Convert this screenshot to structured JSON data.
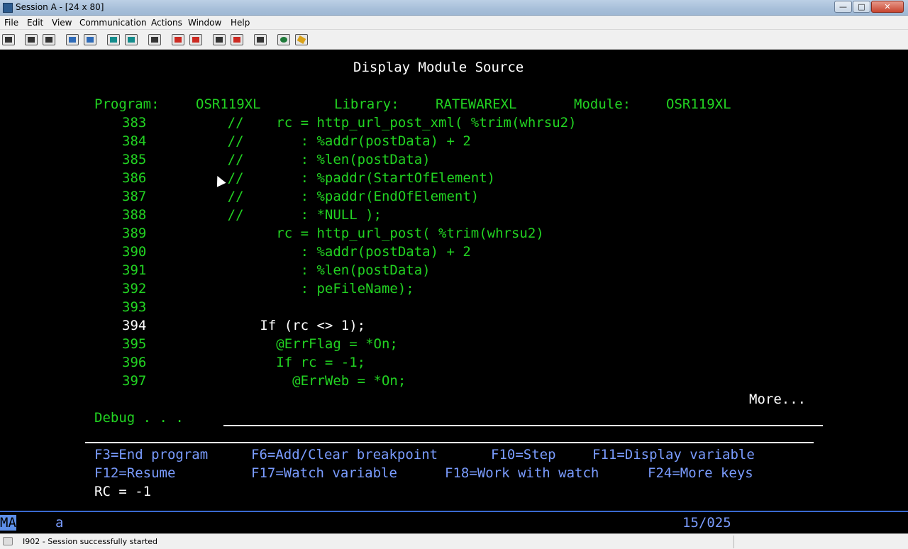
{
  "window": {
    "title": "Session A - [24 x 80]",
    "buttons": {
      "minimize": "—",
      "maximize": "□",
      "close": "✕"
    }
  },
  "menu": [
    "File",
    "Edit",
    "View",
    "Communication",
    "Actions",
    "Window",
    "Help"
  ],
  "toolbar_icons": [
    "print-screen-icon",
    "copy-icon",
    "paste-icon",
    "send-icon",
    "receive-icon",
    "display-icon",
    "keypad-icon",
    "macro-icon",
    "record-macro-icon",
    "stop-macro-icon",
    "play-macro-icon",
    "pause-macro-icon",
    "clipboard-icon",
    "globe-icon",
    "tag-icon"
  ],
  "screen": {
    "title": "Display Module Source",
    "program_label": "Program:",
    "program_value": "OSR119XL",
    "library_label": "Library:",
    "library_value": "RATEWAREXL",
    "module_label": "Module:",
    "module_value": "OSR119XL",
    "source_lines": [
      {
        "num": "383",
        "code": "      //    rc = http_url_post_xml( %trim(whrsu2)",
        "current": false
      },
      {
        "num": "384",
        "code": "      //       : %addr(postData) + 2",
        "current": false
      },
      {
        "num": "385",
        "code": "      //       : %len(postData)",
        "current": false
      },
      {
        "num": "386",
        "code": "      //       : %paddr(StartOfElement)",
        "current": false
      },
      {
        "num": "387",
        "code": "      //       : %paddr(EndOfElement)",
        "current": false
      },
      {
        "num": "388",
        "code": "      //       : *NULL );",
        "current": false
      },
      {
        "num": "389",
        "code": "            rc = http_url_post( %trim(whrsu2)",
        "current": false
      },
      {
        "num": "390",
        "code": "               : %addr(postData) + 2",
        "current": false
      },
      {
        "num": "391",
        "code": "               : %len(postData)",
        "current": false
      },
      {
        "num": "392",
        "code": "               : peFileName);",
        "current": false
      },
      {
        "num": "393",
        "code": "",
        "current": false
      },
      {
        "num": "394",
        "code": "          If (rc <> 1);",
        "current": true
      },
      {
        "num": "395",
        "code": "            @ErrFlag = *On;",
        "current": false
      },
      {
        "num": "396",
        "code": "            If rc = -1;",
        "current": false
      },
      {
        "num": "397",
        "code": "              @ErrWeb = *On;",
        "current": false
      }
    ],
    "more": "More...",
    "debug_label": "Debug . . .",
    "debug_value": "",
    "function_keys_row1": [
      {
        "label": "F3=End program"
      },
      {
        "label": "F6=Add/Clear breakpoint"
      },
      {
        "label": "F10=Step"
      },
      {
        "label": "F11=Display variable"
      }
    ],
    "function_keys_row2": [
      {
        "label": "F12=Resume"
      },
      {
        "label": "F17=Watch variable"
      },
      {
        "label": "F18=Work with watch"
      },
      {
        "label": "F24=More keys"
      }
    ],
    "message": "RC = -1"
  },
  "oia": {
    "mode": "MA",
    "input_indicator": "a",
    "cursor_position": "15/025"
  },
  "statusbar": {
    "text": "I902 - Session successfully started"
  },
  "colors": {
    "green": "#22d322",
    "white": "#ffffff",
    "blue": "#7a9cff",
    "background": "#000000"
  }
}
